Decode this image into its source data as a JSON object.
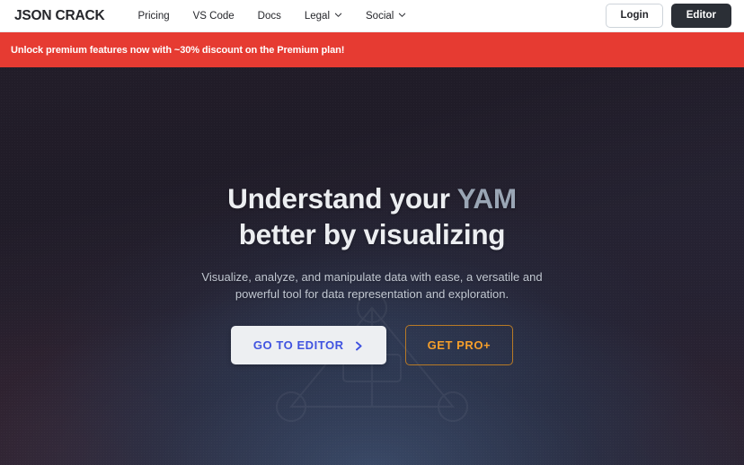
{
  "header": {
    "logo": "JSON CRACK",
    "nav": [
      {
        "label": "Pricing",
        "has_chevron": false,
        "icon": ""
      },
      {
        "label": "VS Code",
        "has_chevron": false,
        "icon": ""
      },
      {
        "label": "Docs",
        "has_chevron": false,
        "icon": ""
      },
      {
        "label": "Legal",
        "has_chevron": true,
        "icon": "chevron-down-icon"
      },
      {
        "label": "Social",
        "has_chevron": true,
        "icon": "chevron-down-icon"
      }
    ],
    "login_label": "Login",
    "editor_label": "Editor"
  },
  "banner": {
    "text": "Unlock premium features now with ~30% discount on the Premium plan!",
    "background_color": "#e63b32",
    "text_color": "#ffffff"
  },
  "hero": {
    "headline_prefix": "Understand your ",
    "headline_dynamic": "YAM",
    "headline_line2": "better by visualizing",
    "subtitle": "Visualize, analyze, and manipulate data with ease, a versatile and powerful tool for data representation and exploration.",
    "cta_primary": "GO TO EDITOR",
    "cta_primary_icon": "chevron-right-icon",
    "cta_secondary": "GET PRO+",
    "colors": {
      "headline": "#eceef1",
      "headline_dynamic": "#9aa6b5",
      "subtitle": "#c2c8d2",
      "cta_primary_text": "#4053e0",
      "cta_primary_bg": "#edeff2",
      "cta_secondary_text": "#f59f2b",
      "cta_secondary_border": "#b87a26",
      "background_dark": "#221d29",
      "background_navy": "#2b3449"
    }
  }
}
